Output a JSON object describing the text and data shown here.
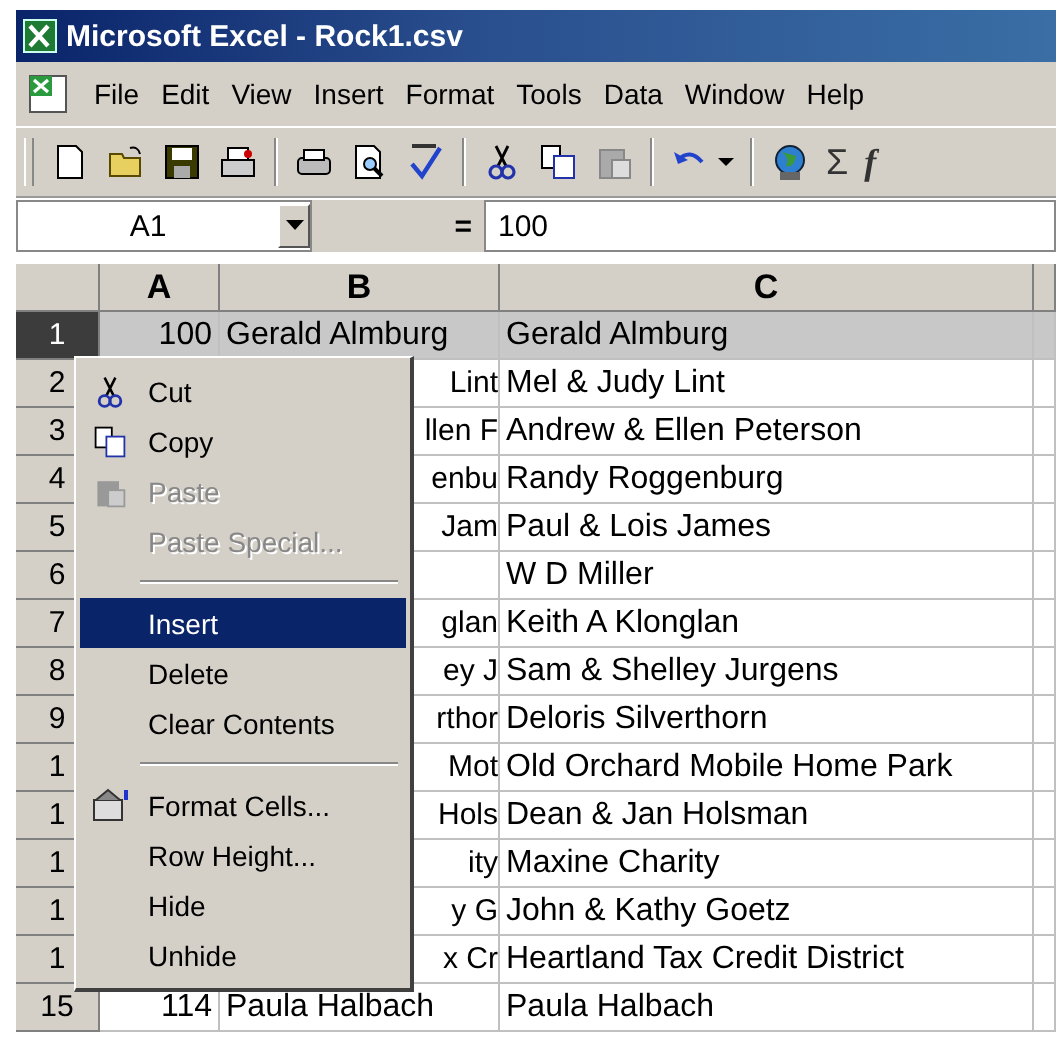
{
  "window": {
    "title": "Microsoft Excel - Rock1.csv"
  },
  "menu_bar": [
    {
      "label": "File"
    },
    {
      "label": "Edit"
    },
    {
      "label": "View"
    },
    {
      "label": "Insert"
    },
    {
      "label": "Format"
    },
    {
      "label": "Tools"
    },
    {
      "label": "Data"
    },
    {
      "label": "Window"
    },
    {
      "label": "Help"
    }
  ],
  "toolbar": {
    "sum": "Σ",
    "function": "f"
  },
  "formula_bar": {
    "name_box": "A1",
    "equals": "=",
    "formula": "100"
  },
  "columns": [
    "A",
    "B",
    "C"
  ],
  "rows": [
    {
      "header": "1",
      "selected": true,
      "a": "100",
      "b": "Gerald Almburg",
      "c": "Gerald Almburg"
    },
    {
      "header": "2",
      "selected": false,
      "b": "Lint",
      "c": "Mel & Judy Lint"
    },
    {
      "header": "3",
      "selected": false,
      "b": "llen F",
      "c": "Andrew & Ellen Peterson"
    },
    {
      "header": "4",
      "selected": false,
      "b": "enbu",
      "c": "Randy Roggenburg"
    },
    {
      "header": "5",
      "selected": false,
      "b": "Jam",
      "c": "Paul & Lois James"
    },
    {
      "header": "6",
      "selected": false,
      "c": "W D Miller"
    },
    {
      "header": "7",
      "selected": false,
      "b": "glan",
      "c": "Keith A Klonglan"
    },
    {
      "header": "8",
      "selected": false,
      "b": "ey J",
      "c": "Sam & Shelley Jurgens"
    },
    {
      "header": "9",
      "selected": false,
      "b": "rthor",
      "c": "Deloris Silverthorn"
    },
    {
      "header": "1",
      "selected": false,
      "b": "Mot",
      "c": "Old Orchard Mobile Home Park"
    },
    {
      "header": "1",
      "selected": false,
      "b": "Hols",
      "c": "Dean & Jan Holsman"
    },
    {
      "header": "1",
      "selected": false,
      "b": "ity",
      "c": "Maxine Charity"
    },
    {
      "header": "1",
      "selected": false,
      "b": "y G",
      "c": "John & Kathy Goetz"
    },
    {
      "header": "1",
      "selected": false,
      "b": "x Cr",
      "c": "Heartland Tax Credit District"
    },
    {
      "header": "15",
      "selected": false,
      "a": "114",
      "b": "Paula Halbach",
      "c": "Paula Halbach"
    }
  ],
  "context_menu": [
    {
      "kind": "item",
      "label": "Cut",
      "selected": false,
      "disabled": false
    },
    {
      "kind": "item",
      "label": "Copy",
      "selected": false,
      "disabled": false
    },
    {
      "kind": "item",
      "label": "Paste",
      "selected": false,
      "disabled": true
    },
    {
      "kind": "item",
      "label": "Paste Special...",
      "selected": false,
      "disabled": true
    },
    {
      "kind": "separator"
    },
    {
      "kind": "item",
      "label": "Insert",
      "selected": true,
      "disabled": false
    },
    {
      "kind": "item",
      "label": "Delete",
      "selected": false,
      "disabled": false
    },
    {
      "kind": "item",
      "label": "Clear Contents",
      "selected": false,
      "disabled": false
    },
    {
      "kind": "separator"
    },
    {
      "kind": "item",
      "label": "Format Cells...",
      "selected": false,
      "disabled": false
    },
    {
      "kind": "item",
      "label": "Row Height...",
      "selected": false,
      "disabled": false
    },
    {
      "kind": "item",
      "label": "Hide",
      "selected": false,
      "disabled": false
    },
    {
      "kind": "item",
      "label": "Unhide",
      "selected": false,
      "disabled": false
    }
  ]
}
